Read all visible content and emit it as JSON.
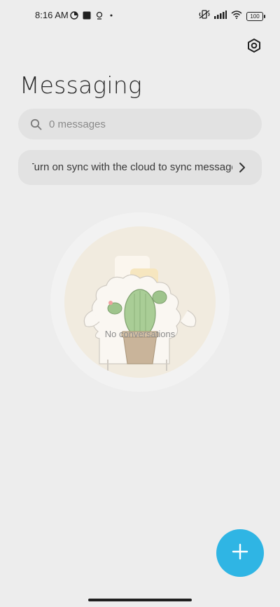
{
  "status_bar": {
    "time": "8:16 AM",
    "battery": "100",
    "left_icons": [
      "data-saver-icon",
      "app-square-icon",
      "location-pin-icon",
      "dot-icon"
    ],
    "right_icons": [
      "vibrate-icon",
      "signal-icon",
      "wifi-icon",
      "battery-icon"
    ]
  },
  "header": {
    "title": "Messaging",
    "settings_icon": "settings-hexagon-icon"
  },
  "search": {
    "placeholder": "0 messages"
  },
  "sync_banner": {
    "text": "Turn on sync with the cloud to sync messages"
  },
  "empty_state": {
    "label": "No conversations",
    "illustration": "sheep-with-cactus-and-chat-bubble"
  },
  "fab": {
    "icon": "plus-icon",
    "color": "#2fb5e4"
  },
  "colors": {
    "background": "#ededed",
    "surface": "#e2e2e2",
    "accent": "#2fb5e4"
  }
}
